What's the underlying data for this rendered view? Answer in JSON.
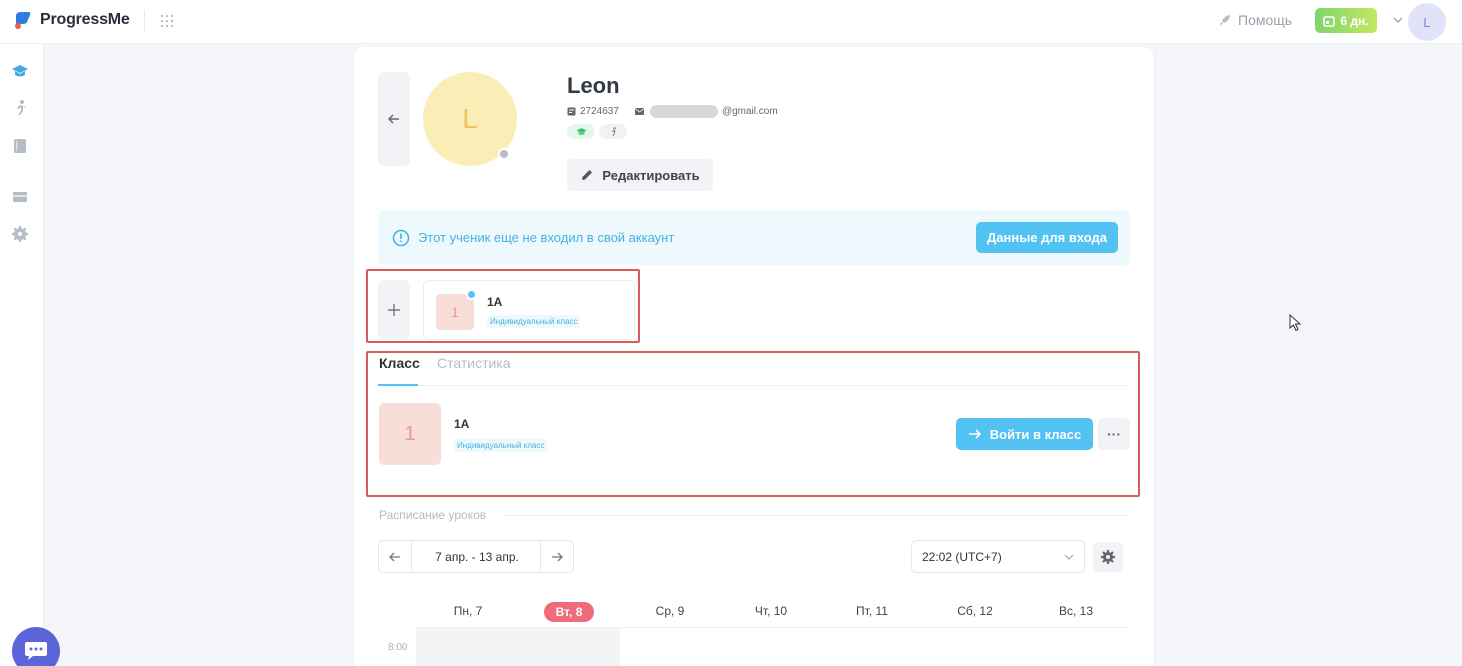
{
  "app": {
    "brand": "ProgressMe"
  },
  "topbar": {
    "help_label": "Помощь",
    "trial_label": "6 дн.",
    "user_initial": "L"
  },
  "profile": {
    "avatar_initial": "L",
    "name": "Leon",
    "id": "2724637",
    "email_suffix": "@gmail.com",
    "edit_label": "Редактировать"
  },
  "notice": {
    "text": "Этот ученик еще не входил в свой аккаунт",
    "button_label": "Данные для входа"
  },
  "class_chip": {
    "badge_number": "1",
    "name": "1A",
    "type": "Индивидуальный класс"
  },
  "tabs": [
    {
      "label": "Класс",
      "active": true
    },
    {
      "label": "Статистика",
      "active": false
    }
  ],
  "class_row": {
    "badge_number": "1",
    "name": "1A",
    "type": "Индивидуальный класс",
    "enter_label": "Войти в класс",
    "more_label": "···"
  },
  "schedule": {
    "title": "Расписание уроков",
    "week_label": "7 апр. - 13 апр.",
    "timezone": "22:02 (UTC+7)",
    "days": [
      "Пн, 7",
      "Вт, 8",
      "Ср, 9",
      "Чт, 10",
      "Пт, 11",
      "Сб, 12",
      "Вс, 13"
    ],
    "today_index": 1,
    "first_hour": "8:00"
  },
  "colors": {
    "accent": "#52c2f2",
    "today": "#ef6b7b",
    "brand": "#5c65d8"
  }
}
